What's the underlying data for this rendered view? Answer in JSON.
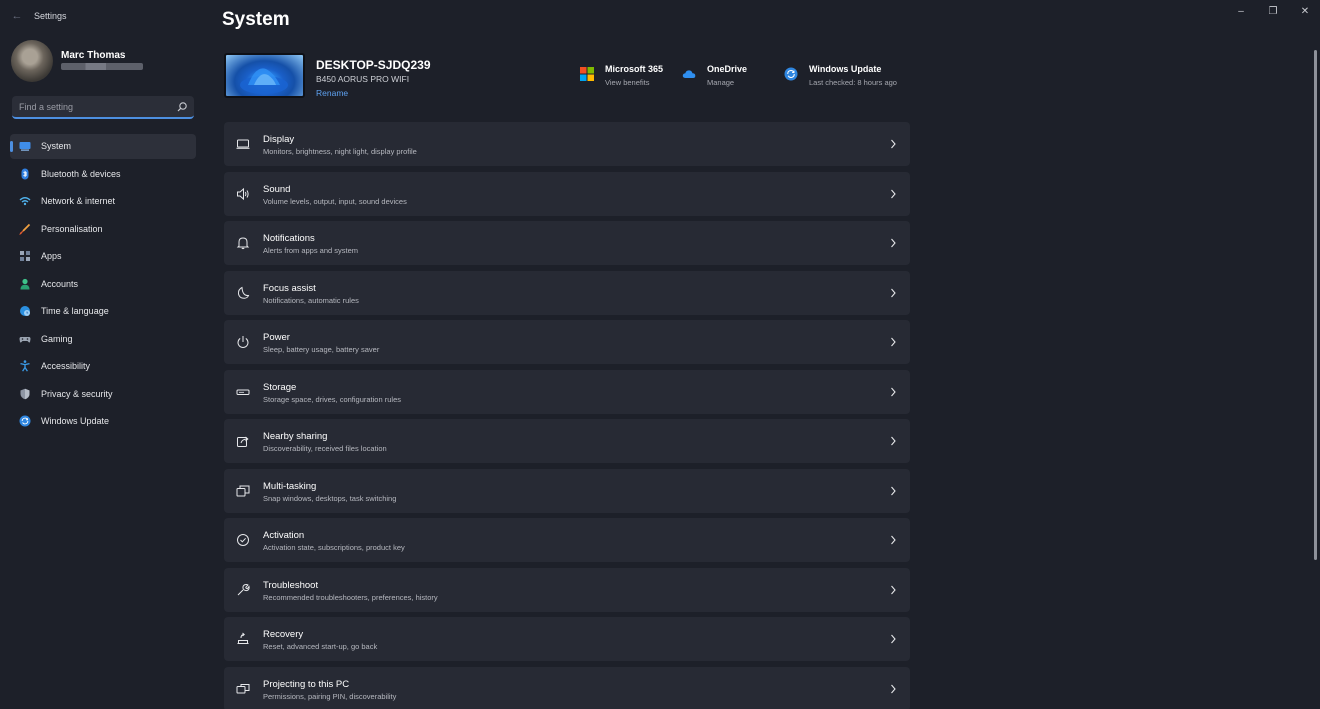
{
  "window": {
    "app_title": "Settings",
    "controls": {
      "minimize": "–",
      "maximize": "❐",
      "close": "✕"
    }
  },
  "profile": {
    "name": "Marc Thomas"
  },
  "search": {
    "placeholder": "Find a setting"
  },
  "sidebar": {
    "items": [
      {
        "label": "System",
        "icon": "monitor-icon",
        "active": true
      },
      {
        "label": "Bluetooth & devices",
        "icon": "bluetooth-icon"
      },
      {
        "label": "Network & internet",
        "icon": "wifi-icon"
      },
      {
        "label": "Personalisation",
        "icon": "brush-icon"
      },
      {
        "label": "Apps",
        "icon": "apps-icon"
      },
      {
        "label": "Accounts",
        "icon": "person-icon"
      },
      {
        "label": "Time & language",
        "icon": "globe-clock-icon"
      },
      {
        "label": "Gaming",
        "icon": "gamepad-icon"
      },
      {
        "label": "Accessibility",
        "icon": "accessibility-icon"
      },
      {
        "label": "Privacy & security",
        "icon": "shield-icon"
      },
      {
        "label": "Windows Update",
        "icon": "update-icon"
      }
    ]
  },
  "main": {
    "title": "System",
    "device": {
      "name": "DESKTOP-SJDQ239",
      "model": "B450 AORUS PRO WIFI",
      "rename": "Rename"
    },
    "quick_links": [
      {
        "title": "Microsoft 365",
        "subtitle": "View benefits",
        "icon": "microsoft-logo-icon"
      },
      {
        "title": "OneDrive",
        "subtitle": "Manage",
        "icon": "cloud-icon"
      },
      {
        "title": "Windows Update",
        "subtitle": "Last checked: 8 hours ago",
        "icon": "update-icon"
      }
    ],
    "settings": [
      {
        "title": "Display",
        "subtitle": "Monitors, brightness, night light, display profile",
        "icon": "display-icon"
      },
      {
        "title": "Sound",
        "subtitle": "Volume levels, output, input, sound devices",
        "icon": "speaker-icon"
      },
      {
        "title": "Notifications",
        "subtitle": "Alerts from apps and system",
        "icon": "bell-icon"
      },
      {
        "title": "Focus assist",
        "subtitle": "Notifications, automatic rules",
        "icon": "moon-icon"
      },
      {
        "title": "Power",
        "subtitle": "Sleep, battery usage, battery saver",
        "icon": "power-icon"
      },
      {
        "title": "Storage",
        "subtitle": "Storage space, drives, configuration rules",
        "icon": "storage-icon"
      },
      {
        "title": "Nearby sharing",
        "subtitle": "Discoverability, received files location",
        "icon": "share-icon"
      },
      {
        "title": "Multi-tasking",
        "subtitle": "Snap windows, desktops, task switching",
        "icon": "multitask-icon"
      },
      {
        "title": "Activation",
        "subtitle": "Activation state, subscriptions, product key",
        "icon": "check-circle-icon"
      },
      {
        "title": "Troubleshoot",
        "subtitle": "Recommended troubleshooters, preferences, history",
        "icon": "wrench-icon"
      },
      {
        "title": "Recovery",
        "subtitle": "Reset, advanced start-up, go back",
        "icon": "recovery-icon"
      },
      {
        "title": "Projecting to this PC",
        "subtitle": "Permissions, pairing PIN, discoverability",
        "icon": "projector-icon"
      }
    ]
  },
  "colors": {
    "background": "#1d2029",
    "card": "#272a34",
    "accent": "#4d8fe0",
    "link": "#5ea1f0"
  }
}
